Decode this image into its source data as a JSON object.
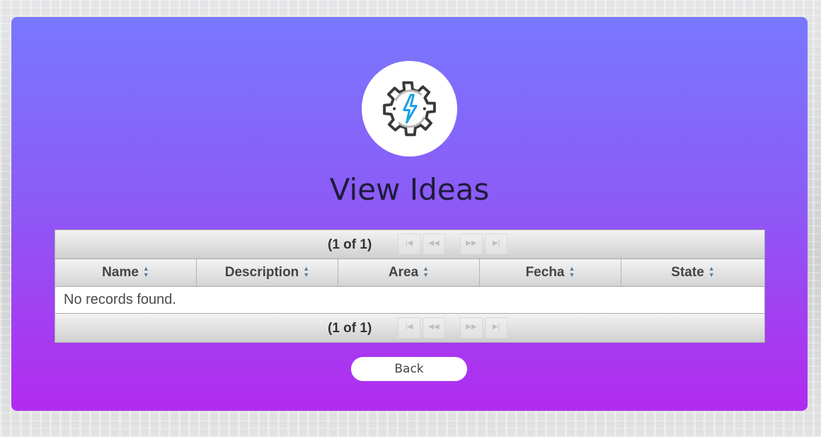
{
  "page": {
    "title": "View Ideas",
    "logo_icon": "gear-lightning-icon",
    "colors": {
      "card_top": "#7978fe",
      "card_bottom": "#b12bf0",
      "lightning": "#1ea0e6"
    }
  },
  "table": {
    "paginator_top": {
      "report": "(1 of 1)",
      "first_icon": "first-page-icon",
      "prev_icon": "previous-page-icon",
      "next_icon": "next-page-icon",
      "last_icon": "last-page-icon"
    },
    "columns": [
      "Name",
      "Description",
      "Area",
      "Fecha",
      "State"
    ],
    "sort_icon": "sort-icon",
    "empty_message": "No records found.",
    "paginator_bottom": {
      "report": "(1 of 1)"
    }
  },
  "actions": {
    "back_label": "Back"
  }
}
